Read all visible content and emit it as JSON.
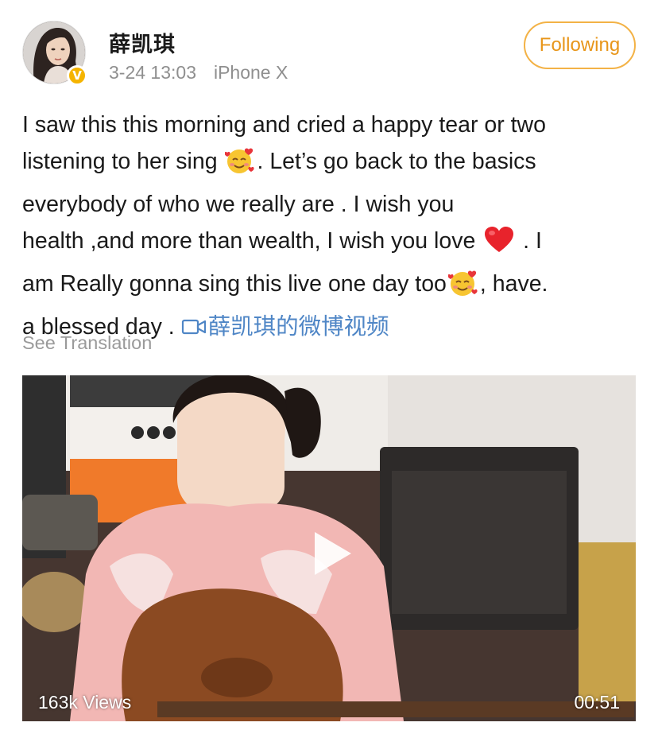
{
  "user": {
    "name": "薛凯琪",
    "date": "3-24 13:03",
    "device": "iPhone X",
    "verified_badge": "V",
    "verified_color": "#f5b400"
  },
  "follow_button": {
    "label": "Following",
    "color": "#e8961a"
  },
  "post": {
    "lines": [
      "I saw this this morning and cried a happy tear or two",
      "listening to her sing",
      ". Let’s go back to the basics",
      "everybody of who we really are . I wish you",
      "health ,and more than wealth, I wish you love",
      " . I",
      "am Really gonna sing this live one day too",
      ", have.",
      "a blessed day . "
    ],
    "emojis": [
      "smiling-face-with-hearts-icon",
      "red-heart-icon",
      "smiling-face-with-hearts-icon"
    ],
    "video_link": "薛凯琪的微博视频",
    "link_color": "#4f86c6"
  },
  "see_translation": "See Translation",
  "video": {
    "views": "163k Views",
    "duration": "00:51",
    "play_icon": "play-icon"
  }
}
